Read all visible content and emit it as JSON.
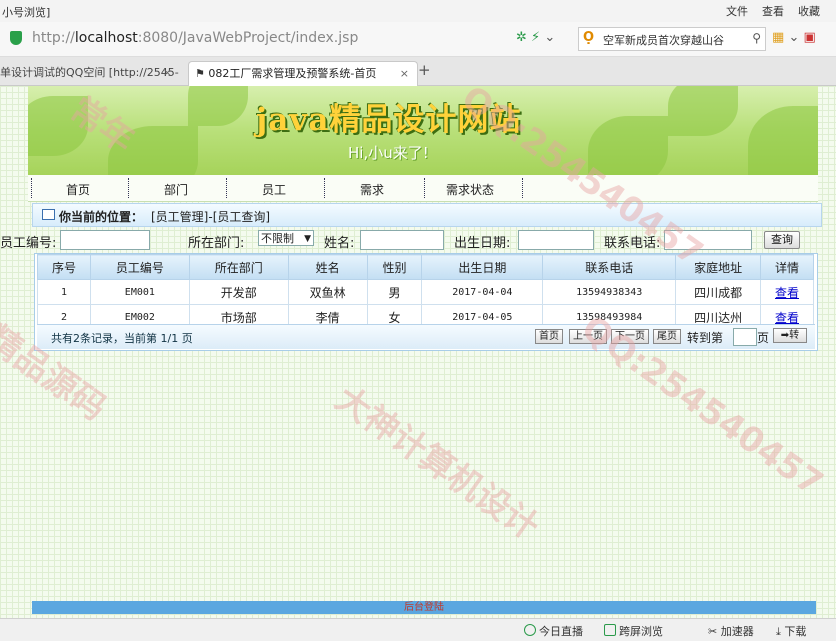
{
  "browser": {
    "window_title_fragment": "小号浏览]",
    "menu": [
      "文件",
      "查看",
      "收藏"
    ],
    "url_prefix": "http://",
    "url_host": "localhost",
    "url_rest": ":8080/JavaWebProject/index.jsp",
    "search_text": "空军新成员首次穿越山谷",
    "tabs": [
      {
        "label": "单设计调试的QQ空间 [http://2545-",
        "active": false
      },
      {
        "label": "082工厂需求管理及预警系统-首页",
        "active": true
      }
    ]
  },
  "site": {
    "title": "java精品设计网站",
    "subtitle": "Hi,小u来了!",
    "nav": [
      "首页",
      "部门",
      "员工",
      "需求",
      "需求状态"
    ]
  },
  "position": {
    "label": "你当前的位置：",
    "path": "[员工管理]-[员工查询]"
  },
  "search_form": {
    "employee_no_label": "员工编号:",
    "employee_no_value": "",
    "dept_label": "所在部门:",
    "dept_selected": "不限制",
    "name_label": "姓名:",
    "name_value": "",
    "birth_label": "出生日期:",
    "birth_value": "",
    "phone_label": "联系电话:",
    "phone_value": "",
    "query_button": "查询"
  },
  "table": {
    "columns": [
      "序号",
      "员工编号",
      "所在部门",
      "姓名",
      "性别",
      "出生日期",
      "联系电话",
      "家庭地址",
      "详情"
    ],
    "rows": [
      {
        "index": "1",
        "emp_no": "EM001",
        "dept": "开发部",
        "name": "双鱼林",
        "gender": "男",
        "birth": "2017-04-04",
        "phone": "13594938343",
        "address": "四川成都",
        "action": "查看"
      },
      {
        "index": "2",
        "emp_no": "EM002",
        "dept": "市场部",
        "name": "李倩",
        "gender": "女",
        "birth": "2017-04-05",
        "phone": "13598493984",
        "address": "四川达州",
        "action": "查看"
      }
    ]
  },
  "pager": {
    "info": "共有2条记录，当前第 1/1 页",
    "buttons": [
      "首页",
      "上一页",
      "下一页",
      "尾页"
    ],
    "goto_label": "转到第",
    "goto_value": "",
    "page_label": "页",
    "go_button": "➡转"
  },
  "footer": {
    "backstage_link": "后台登陆"
  },
  "statusbar": {
    "items": [
      "今日直播",
      "跨屏浏览",
      "加速器",
      "下载"
    ]
  },
  "watermarks": [
    "大神计算机设计",
    "QQ:254540457",
    "精品源码",
    "常年"
  ],
  "colors": {
    "banner_green": "#a6d35a",
    "title_yellow": "#ffd23a",
    "link_blue": "#0000cc",
    "backstage_bar": "#5ba7e0"
  }
}
